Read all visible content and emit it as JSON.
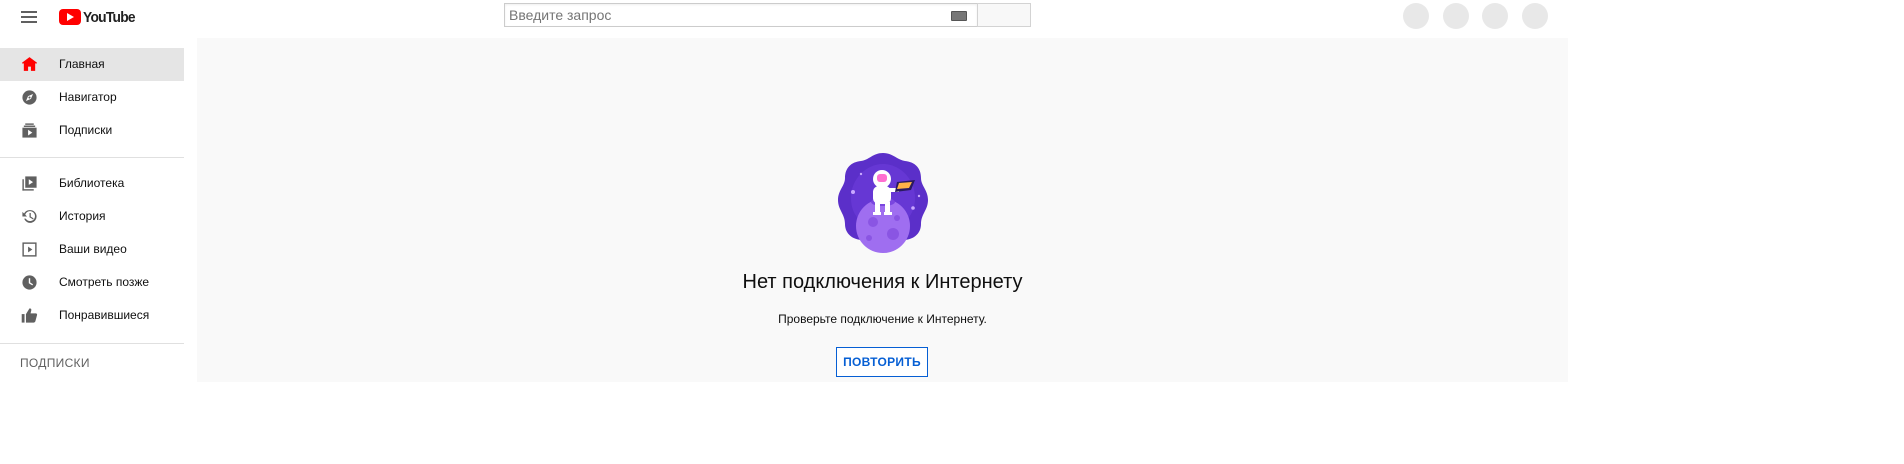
{
  "header": {
    "logo_text": "YouTube",
    "search_placeholder": "Введите запрос",
    "brand_color": "#ff0000"
  },
  "sidebar": {
    "items": [
      {
        "label": "Главная",
        "icon": "home-icon",
        "active": true
      },
      {
        "label": "Навигатор",
        "icon": "compass-icon"
      },
      {
        "label": "Подписки",
        "icon": "subscriptions-icon"
      },
      {
        "label": "Библиотека",
        "icon": "library-icon"
      },
      {
        "label": "История",
        "icon": "history-icon"
      },
      {
        "label": "Ваши видео",
        "icon": "your-videos-icon"
      },
      {
        "label": "Смотреть позже",
        "icon": "watch-later-icon"
      },
      {
        "label": "Понравившиеся",
        "icon": "thumbs-up-icon"
      }
    ],
    "section_title": "ПОДПИСКИ"
  },
  "main": {
    "error_title": "Нет подключения к Интернету",
    "error_subtitle": "Проверьте подключение к Интернету.",
    "retry_label": "ПОВТОРИТЬ",
    "accent_color": "#065fd4"
  }
}
